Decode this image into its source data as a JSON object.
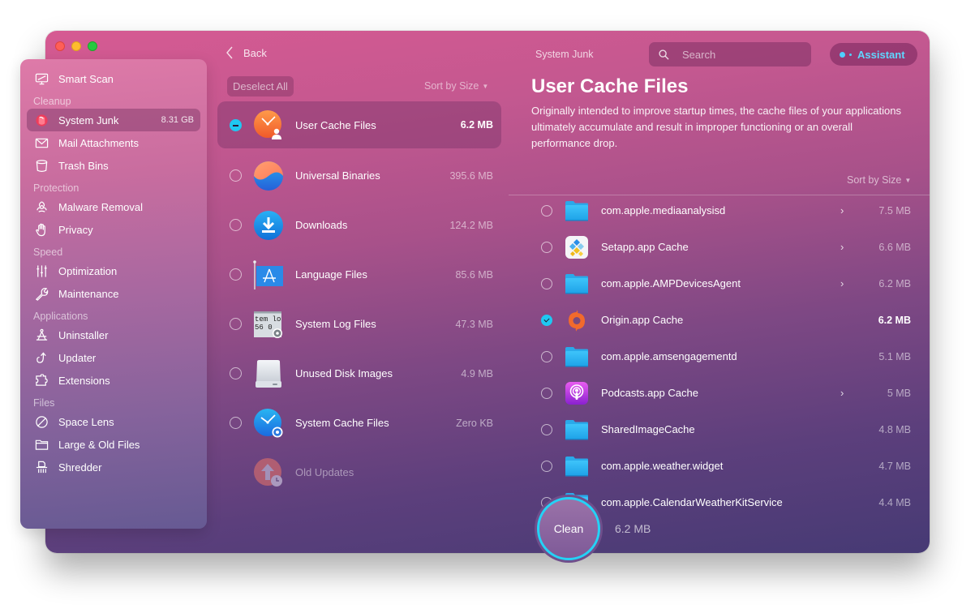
{
  "window": {
    "traffic_lights": [
      "close",
      "minimize",
      "maximize"
    ]
  },
  "sidebar": {
    "items": [
      {
        "type": "item",
        "label": "Smart Scan",
        "icon": "monitor-icon"
      },
      {
        "type": "section",
        "label": "Cleanup"
      },
      {
        "type": "item",
        "label": "System Junk",
        "icon": "system-junk-icon",
        "badge": "8.31 GB",
        "active": true
      },
      {
        "type": "item",
        "label": "Mail Attachments",
        "icon": "envelope-icon"
      },
      {
        "type": "item",
        "label": "Trash Bins",
        "icon": "trash-icon"
      },
      {
        "type": "section",
        "label": "Protection"
      },
      {
        "type": "item",
        "label": "Malware Removal",
        "icon": "biohazard-icon"
      },
      {
        "type": "item",
        "label": "Privacy",
        "icon": "hand-icon"
      },
      {
        "type": "section",
        "label": "Speed"
      },
      {
        "type": "item",
        "label": "Optimization",
        "icon": "sliders-icon"
      },
      {
        "type": "item",
        "label": "Maintenance",
        "icon": "wrench-icon"
      },
      {
        "type": "section",
        "label": "Applications"
      },
      {
        "type": "item",
        "label": "Uninstaller",
        "icon": "uninstaller-icon"
      },
      {
        "type": "item",
        "label": "Updater",
        "icon": "update-arrow-icon"
      },
      {
        "type": "item",
        "label": "Extensions",
        "icon": "puzzle-icon"
      },
      {
        "type": "section",
        "label": "Files"
      },
      {
        "type": "item",
        "label": "Space Lens",
        "icon": "planet-icon"
      },
      {
        "type": "item",
        "label": "Large & Old Files",
        "icon": "folder-icon"
      },
      {
        "type": "item",
        "label": "Shredder",
        "icon": "shredder-icon"
      }
    ]
  },
  "middle": {
    "back_label": "Back",
    "deselect_label": "Deselect All",
    "sort_label": "Sort by Size",
    "categories": [
      {
        "name": "User Cache Files",
        "size": "6.2 MB",
        "icon": "user-cache-icon",
        "state": "partial",
        "active": true
      },
      {
        "name": "Universal Binaries",
        "size": "395.6 MB",
        "icon": "universal-binaries-icon",
        "state": "unchecked"
      },
      {
        "name": "Downloads",
        "size": "124.2 MB",
        "icon": "downloads-icon",
        "state": "unchecked"
      },
      {
        "name": "Language Files",
        "size": "85.6 MB",
        "icon": "language-flag-icon",
        "state": "unchecked"
      },
      {
        "name": "System Log Files",
        "size": "47.3 MB",
        "icon": "system-log-icon",
        "state": "unchecked"
      },
      {
        "name": "Unused Disk Images",
        "size": "4.9 MB",
        "icon": "disk-image-icon",
        "state": "unchecked"
      },
      {
        "name": "System Cache Files",
        "size": "Zero KB",
        "icon": "system-cache-icon",
        "state": "unchecked"
      },
      {
        "name": "Old Updates",
        "size": "",
        "icon": "old-updates-icon",
        "state": "disabled"
      }
    ]
  },
  "right": {
    "breadcrumb": "System Junk",
    "search_placeholder": "Search",
    "assistant_label": "Assistant",
    "title": "User Cache Files",
    "description": "Originally intended to improve startup times, the cache files of your applications ultimately accumulate and result in improper functioning or an overall performance drop.",
    "sort_label": "Sort by Size",
    "files": [
      {
        "name": "com.apple.mediaanalysisd",
        "size": "7.5 MB",
        "icon": "folder",
        "chevron": true,
        "checked": false
      },
      {
        "name": "Setapp.app Cache",
        "size": "6.6 MB",
        "icon": "setapp",
        "chevron": true,
        "checked": false
      },
      {
        "name": "com.apple.AMPDevicesAgent",
        "size": "6.2 MB",
        "icon": "folder",
        "chevron": true,
        "checked": false
      },
      {
        "name": "Origin.app Cache",
        "size": "6.2 MB",
        "icon": "origin",
        "chevron": false,
        "checked": true
      },
      {
        "name": "com.apple.amsengagementd",
        "size": "5.1 MB",
        "icon": "folder",
        "chevron": false,
        "checked": false
      },
      {
        "name": "Podcasts.app Cache",
        "size": "5 MB",
        "icon": "podcasts",
        "chevron": true,
        "checked": false
      },
      {
        "name": "SharedImageCache",
        "size": "4.8 MB",
        "icon": "folder",
        "chevron": false,
        "checked": false
      },
      {
        "name": "com.apple.weather.widget",
        "size": "4.7 MB",
        "icon": "folder",
        "chevron": false,
        "checked": false
      },
      {
        "name": "com.apple.CalendarWeatherKitService",
        "size": "4.4 MB",
        "icon": "folder",
        "chevron": false,
        "checked": false
      }
    ],
    "chevron_glyph": "›"
  },
  "clean": {
    "label": "Clean",
    "size": "6.2 MB"
  },
  "colors": {
    "accent": "#1fc8f2",
    "assistant_text": "#5fd6ff"
  }
}
